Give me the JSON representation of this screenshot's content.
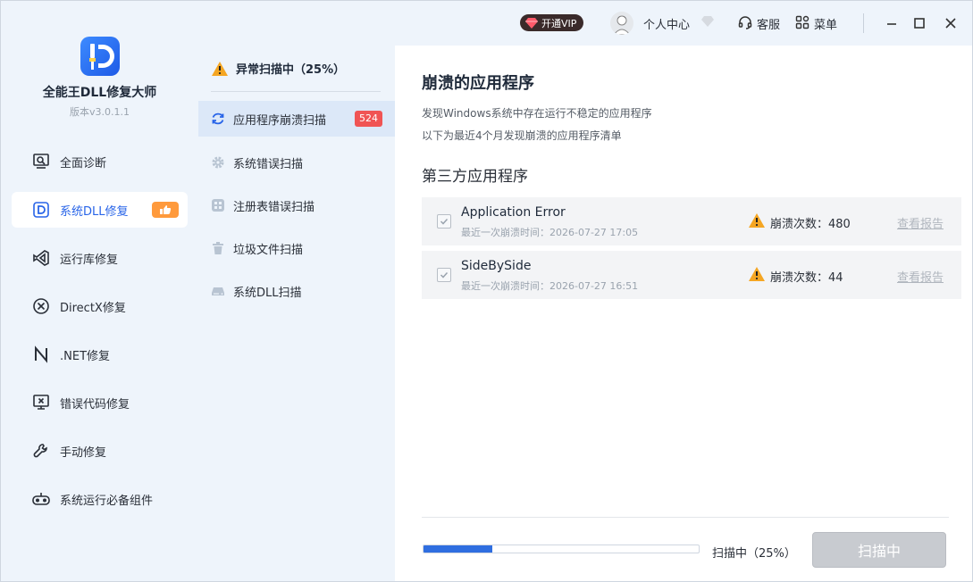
{
  "app": {
    "title": "全能王DLL修复大师",
    "version": "版本v3.0.1.1"
  },
  "sidebar": {
    "items": [
      {
        "label": "全面诊断",
        "icon": "monitor-search-icon"
      },
      {
        "label": "系统DLL修复",
        "icon": "dll-d-icon",
        "active": true,
        "badge_icon": "thumbs-up-icon"
      },
      {
        "label": "运行库修复",
        "icon": "visual-studio-icon"
      },
      {
        "label": "DirectX修复",
        "icon": "directx-icon"
      },
      {
        "label": ".NET修复",
        "icon": "dotnet-n-icon"
      },
      {
        "label": "错误代码修复",
        "icon": "monitor-error-icon"
      },
      {
        "label": "手动修复",
        "icon": "wrench-icon"
      },
      {
        "label": "系统运行必备组件",
        "icon": "controller-icon"
      }
    ]
  },
  "topbar": {
    "vip_label": "开通VIP",
    "user_center": "个人中心",
    "service": "客服",
    "menu": "菜单"
  },
  "scan_panel": {
    "status": "异常扫描中（25%）",
    "items": [
      {
        "label": "应用程序崩溃扫描",
        "icon": "refresh-icon",
        "active": true,
        "count": "524"
      },
      {
        "label": "系统错误扫描",
        "icon": "gear-icon"
      },
      {
        "label": "注册表错误扫描",
        "icon": "registry-icon"
      },
      {
        "label": "垃圾文件扫描",
        "icon": "trash-icon"
      },
      {
        "label": "系统DLL扫描",
        "icon": "drive-icon"
      }
    ]
  },
  "main": {
    "title": "崩溃的应用程序",
    "desc1": "发现Windows系统中存在运行不稳定的应用程序",
    "desc2": "以下为最近4个月发现崩溃的应用程序清单",
    "section_title": "第三方应用程序",
    "crashes": [
      {
        "name": "Application Error",
        "time": "最近一次崩溃时间：2026-07-27 17:05",
        "count_label": "崩溃次数：480",
        "report": "查看报告"
      },
      {
        "name": "SideBySide",
        "time": "最近一次崩溃时间：2026-07-27 16:51",
        "count_label": "崩溃次数：44",
        "report": "查看报告"
      }
    ],
    "progress_percent": 25,
    "progress_text": "扫描中（25%）",
    "scan_button": "扫描中"
  },
  "colors": {
    "accent": "#2864e8",
    "sidebar_bg": "#eef4fb",
    "badge_red": "#f05454",
    "warn_orange": "#f5a623"
  }
}
